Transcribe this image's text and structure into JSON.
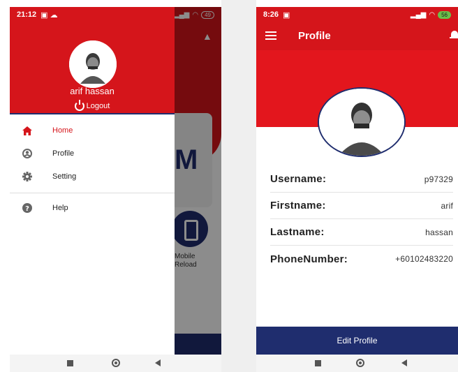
{
  "left_screen": {
    "status": {
      "time": "21:12",
      "battery": "49"
    },
    "background": {
      "card_letter": "M",
      "reload_label_line1": "Mobile",
      "reload_label_line2": "Reload"
    },
    "drawer": {
      "user_name": "arif hassan",
      "logout_label": "Logout",
      "items": [
        {
          "label": "Home",
          "icon": "home-icon",
          "active": true
        },
        {
          "label": "Profile",
          "icon": "account-circle-icon",
          "active": false
        },
        {
          "label": "Setting",
          "icon": "gear-icon",
          "active": false
        },
        {
          "label": "Help",
          "icon": "help-circle-icon",
          "active": false
        }
      ]
    }
  },
  "right_screen": {
    "status": {
      "time": "8:26",
      "battery": "56"
    },
    "appbar": {
      "title": "Profile"
    },
    "fields": [
      {
        "label": "Username:",
        "value": "p97329"
      },
      {
        "label": "Firstname:",
        "value": "arif"
      },
      {
        "label": "Lastname:",
        "value": "hassan"
      },
      {
        "label": "PhoneNumber:",
        "value": "+60102483220"
      }
    ],
    "edit_button": "Edit Profile"
  },
  "colors": {
    "brand_red": "#d5151b",
    "navy": "#1f2d6e",
    "active_text": "#d5151b"
  }
}
